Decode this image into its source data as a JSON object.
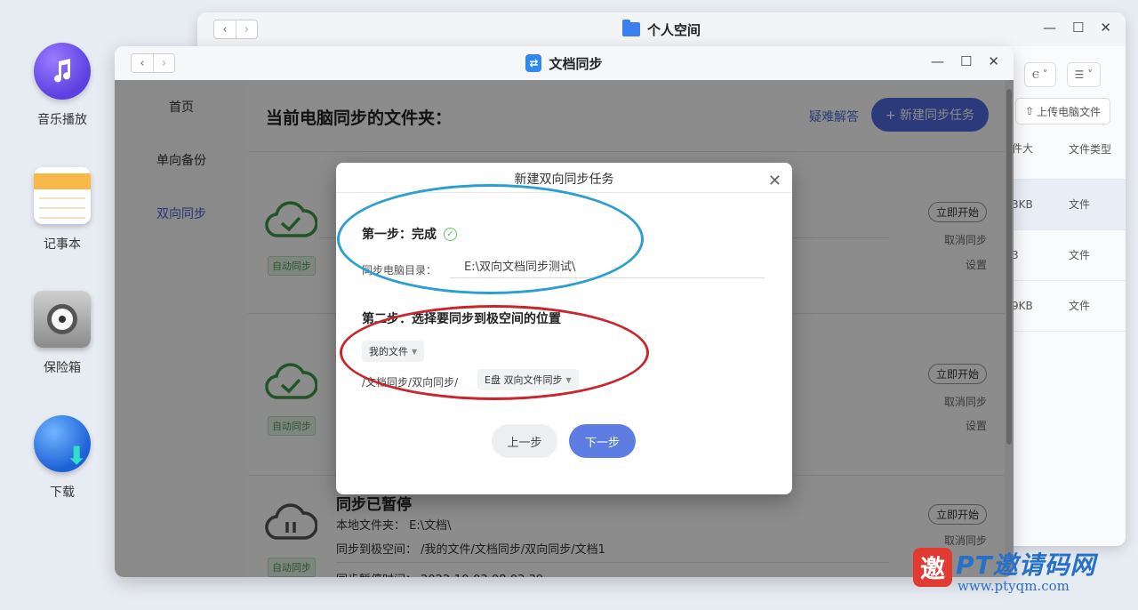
{
  "desktop": {
    "icons": [
      {
        "label": "音乐播放"
      },
      {
        "label": "记事本"
      },
      {
        "label": "保险箱"
      },
      {
        "label": "下载"
      }
    ]
  },
  "bg_window": {
    "title": "个人空间",
    "toolbar": {
      "view_btn": "Ⲉ ˅",
      "sort_btn": "☰ ˅"
    },
    "upload_label": "上传电脑文件",
    "table": {
      "headers": [
        "件大",
        "文件类型"
      ],
      "rows": [
        {
          "size": "3KB",
          "type": "文件"
        },
        {
          "size": "3",
          "type": "文件"
        },
        {
          "size": "9KB",
          "type": "文件"
        }
      ]
    }
  },
  "main_window": {
    "title": "文档同步",
    "sidebar": [
      "首页",
      "单向备份",
      "双向同步"
    ],
    "content_title": "当前电脑同步的文件夹：",
    "faq_label": "疑难解答",
    "new_task_label": "+ 新建同步任务",
    "tasks": [
      {
        "badge": "自动同步",
        "start": "立即开始",
        "cancel": "取消同步",
        "settings": "设置"
      },
      {
        "badge": "自动同步",
        "start": "立即开始",
        "cancel": "取消同步",
        "settings": "设置"
      },
      {
        "badge": "自动同步",
        "start": "立即开始",
        "cancel": "取消同步",
        "heading": "同步已暂停",
        "local_folder": "本地文件夹：  E:\\文档\\",
        "remote": "同步到极空间：  /我的文件/文档同步/双向同步/文档1",
        "time": "同步暂停时间：  2022-10-03 08:03:39"
      }
    ]
  },
  "dialog": {
    "title": "新建双向同步任务",
    "step1_title": "第一步：完成",
    "dir_label": "同步电脑目录：",
    "dir_value": "E:\\双向文档同步测试\\",
    "step2_title": "第二步：选择要同步到极空间的位置",
    "my_files": "我的文件",
    "path_prefix": "/文档同步/双向同步/",
    "target_folder": "E盘 双向文件同步",
    "prev_label": "上一步",
    "next_label": "下一步"
  },
  "watermark": {
    "logo": "邀",
    "main": "PT邀请码网",
    "url": "www.ptyqm.com"
  },
  "colors": {
    "accent": "#4f6be0",
    "success": "#4a9e52",
    "annotation_blue": "#2a9fd0",
    "annotation_red": "#c9252c"
  }
}
